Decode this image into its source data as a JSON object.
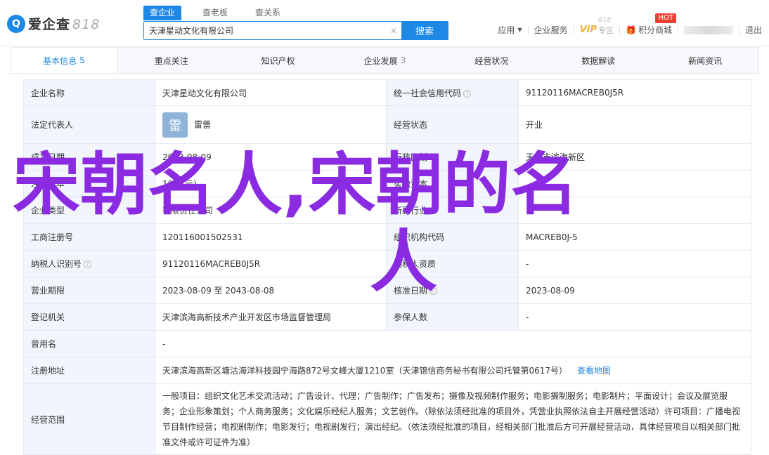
{
  "header": {
    "logo_mark": "Q",
    "logo_text": "爱企查",
    "logo_num": "818",
    "search_tabs": [
      "查企业",
      "查老板",
      "查关系"
    ],
    "search_value": "天津星动文化有限公司",
    "search_button": "搜索",
    "links": {
      "app": "应用",
      "enterprise_service": "企业服务",
      "vip": "VIP",
      "vip_sub": "专区",
      "vip_num": "818",
      "points_mall": "积分商城",
      "hot": "HOT",
      "logout": "退出"
    }
  },
  "nav": {
    "items": [
      {
        "label": "基本信息",
        "count": "5"
      },
      {
        "label": "重点关注",
        "count": ""
      },
      {
        "label": "知识产权",
        "count": ""
      },
      {
        "label": "企业发展",
        "count": "3"
      },
      {
        "label": "经营状况",
        "count": ""
      },
      {
        "label": "数据解读",
        "count": ""
      },
      {
        "label": "新闻资讯",
        "count": ""
      }
    ]
  },
  "info": {
    "company_name_label": "企业名称",
    "company_name": "天津星动文化有限公司",
    "credit_code_label": "统一社会信用代码",
    "credit_code": "91120116MACREB0J5R",
    "legal_rep_label": "法定代表人",
    "legal_rep_avatar": "雷",
    "legal_rep": "雷蕾",
    "status_label": "经营状态",
    "status": "开业",
    "est_date_label": "成立日期",
    "est_date": "2023-08-09",
    "region_label": "行政区划",
    "region": "天津市滨海新区",
    "capital_label": "注册资本",
    "capital": "10万(元)",
    "paid_label": "实缴资本",
    "paid": "",
    "type_label": "企业类型",
    "type": "有限责任公司",
    "industry_label": "所属行业",
    "industry": "",
    "reg_no_label": "工商注册号",
    "reg_no": "120116001502531",
    "org_code_label": "组织机构代码",
    "org_code": "MACREB0J-5",
    "taxpayer_id_label": "纳税人识别号",
    "taxpayer_id": "91120116MACREB0J5R",
    "taxpayer_qual_label": "纳税人资质",
    "taxpayer_qual": "-",
    "term_label": "营业期限",
    "term": "2023-08-09 至 2043-08-08",
    "approve_date_label": "核准日期",
    "approve_date": "2023-08-09",
    "authority_label": "登记机关",
    "authority": "天津滨海高新技术产业开发区市场监督管理局",
    "insured_label": "参保人数",
    "insured": "-",
    "former_name_label": "曾用名",
    "former_name": "-",
    "address_label": "注册地址",
    "address": "天津滨海高新区塘沽海洋科技园宁海路872号文峰大厦1210室（天津锦信商务秘书有限公司托管第0617号）",
    "map_link": "查看地图",
    "scope_label": "经营范围",
    "scope": "一般项目：组织文化艺术交流活动；广告设计、代理；广告制作；广告发布；摄像及视频制作服务；电影摄制服务；电影制片；平面设计；会议及展览服务；企业形象策划；个人商务服务；文化娱乐经纪人服务；文艺创作。（除依法须经批准的项目外，凭营业执照依法自主开展经营活动）许可项目：广播电视节目制作经营；电视剧制作；电影发行；电视剧发行；演出经纪。（依法须经批准的项目，经相关部门批准后方可开展经营活动，具体经营项目以相关部门批准文件或许可证件为准）"
  },
  "overlay": {
    "line1": "宋朝名人,宋朝的名",
    "line2": "人",
    "color": "#8a2be2"
  }
}
